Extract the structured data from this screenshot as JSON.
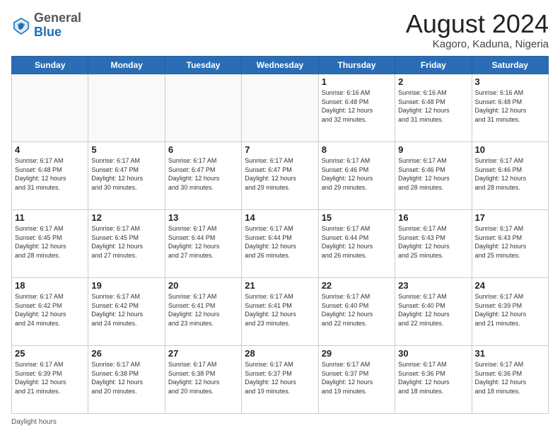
{
  "logo": {
    "general": "General",
    "blue": "Blue"
  },
  "header": {
    "month_year": "August 2024",
    "location": "Kagoro, Kaduna, Nigeria"
  },
  "days_of_week": [
    "Sunday",
    "Monday",
    "Tuesday",
    "Wednesday",
    "Thursday",
    "Friday",
    "Saturday"
  ],
  "footer": {
    "label": "Daylight hours"
  },
  "weeks": [
    [
      {
        "day": "",
        "info": ""
      },
      {
        "day": "",
        "info": ""
      },
      {
        "day": "",
        "info": ""
      },
      {
        "day": "",
        "info": ""
      },
      {
        "day": "1",
        "info": "Sunrise: 6:16 AM\nSunset: 6:48 PM\nDaylight: 12 hours\nand 32 minutes."
      },
      {
        "day": "2",
        "info": "Sunrise: 6:16 AM\nSunset: 6:48 PM\nDaylight: 12 hours\nand 31 minutes."
      },
      {
        "day": "3",
        "info": "Sunrise: 6:16 AM\nSunset: 6:48 PM\nDaylight: 12 hours\nand 31 minutes."
      }
    ],
    [
      {
        "day": "4",
        "info": "Sunrise: 6:17 AM\nSunset: 6:48 PM\nDaylight: 12 hours\nand 31 minutes."
      },
      {
        "day": "5",
        "info": "Sunrise: 6:17 AM\nSunset: 6:47 PM\nDaylight: 12 hours\nand 30 minutes."
      },
      {
        "day": "6",
        "info": "Sunrise: 6:17 AM\nSunset: 6:47 PM\nDaylight: 12 hours\nand 30 minutes."
      },
      {
        "day": "7",
        "info": "Sunrise: 6:17 AM\nSunset: 6:47 PM\nDaylight: 12 hours\nand 29 minutes."
      },
      {
        "day": "8",
        "info": "Sunrise: 6:17 AM\nSunset: 6:46 PM\nDaylight: 12 hours\nand 29 minutes."
      },
      {
        "day": "9",
        "info": "Sunrise: 6:17 AM\nSunset: 6:46 PM\nDaylight: 12 hours\nand 28 minutes."
      },
      {
        "day": "10",
        "info": "Sunrise: 6:17 AM\nSunset: 6:46 PM\nDaylight: 12 hours\nand 28 minutes."
      }
    ],
    [
      {
        "day": "11",
        "info": "Sunrise: 6:17 AM\nSunset: 6:45 PM\nDaylight: 12 hours\nand 28 minutes."
      },
      {
        "day": "12",
        "info": "Sunrise: 6:17 AM\nSunset: 6:45 PM\nDaylight: 12 hours\nand 27 minutes."
      },
      {
        "day": "13",
        "info": "Sunrise: 6:17 AM\nSunset: 6:44 PM\nDaylight: 12 hours\nand 27 minutes."
      },
      {
        "day": "14",
        "info": "Sunrise: 6:17 AM\nSunset: 6:44 PM\nDaylight: 12 hours\nand 26 minutes."
      },
      {
        "day": "15",
        "info": "Sunrise: 6:17 AM\nSunset: 6:44 PM\nDaylight: 12 hours\nand 26 minutes."
      },
      {
        "day": "16",
        "info": "Sunrise: 6:17 AM\nSunset: 6:43 PM\nDaylight: 12 hours\nand 25 minutes."
      },
      {
        "day": "17",
        "info": "Sunrise: 6:17 AM\nSunset: 6:43 PM\nDaylight: 12 hours\nand 25 minutes."
      }
    ],
    [
      {
        "day": "18",
        "info": "Sunrise: 6:17 AM\nSunset: 6:42 PM\nDaylight: 12 hours\nand 24 minutes."
      },
      {
        "day": "19",
        "info": "Sunrise: 6:17 AM\nSunset: 6:42 PM\nDaylight: 12 hours\nand 24 minutes."
      },
      {
        "day": "20",
        "info": "Sunrise: 6:17 AM\nSunset: 6:41 PM\nDaylight: 12 hours\nand 23 minutes."
      },
      {
        "day": "21",
        "info": "Sunrise: 6:17 AM\nSunset: 6:41 PM\nDaylight: 12 hours\nand 23 minutes."
      },
      {
        "day": "22",
        "info": "Sunrise: 6:17 AM\nSunset: 6:40 PM\nDaylight: 12 hours\nand 22 minutes."
      },
      {
        "day": "23",
        "info": "Sunrise: 6:17 AM\nSunset: 6:40 PM\nDaylight: 12 hours\nand 22 minutes."
      },
      {
        "day": "24",
        "info": "Sunrise: 6:17 AM\nSunset: 6:39 PM\nDaylight: 12 hours\nand 21 minutes."
      }
    ],
    [
      {
        "day": "25",
        "info": "Sunrise: 6:17 AM\nSunset: 6:39 PM\nDaylight: 12 hours\nand 21 minutes."
      },
      {
        "day": "26",
        "info": "Sunrise: 6:17 AM\nSunset: 6:38 PM\nDaylight: 12 hours\nand 20 minutes."
      },
      {
        "day": "27",
        "info": "Sunrise: 6:17 AM\nSunset: 6:38 PM\nDaylight: 12 hours\nand 20 minutes."
      },
      {
        "day": "28",
        "info": "Sunrise: 6:17 AM\nSunset: 6:37 PM\nDaylight: 12 hours\nand 19 minutes."
      },
      {
        "day": "29",
        "info": "Sunrise: 6:17 AM\nSunset: 6:37 PM\nDaylight: 12 hours\nand 19 minutes."
      },
      {
        "day": "30",
        "info": "Sunrise: 6:17 AM\nSunset: 6:36 PM\nDaylight: 12 hours\nand 18 minutes."
      },
      {
        "day": "31",
        "info": "Sunrise: 6:17 AM\nSunset: 6:36 PM\nDaylight: 12 hours\nand 18 minutes."
      }
    ]
  ]
}
